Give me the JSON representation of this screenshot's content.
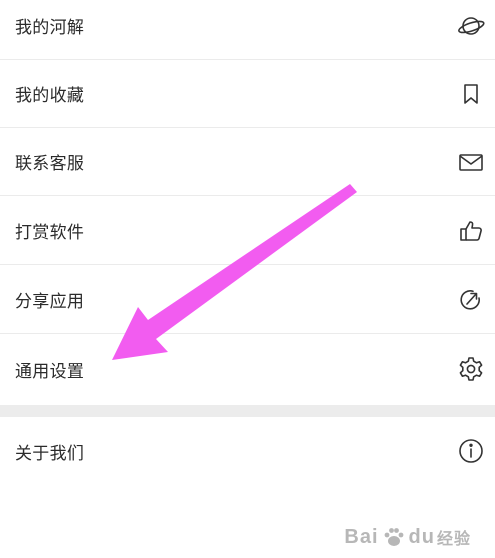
{
  "menu": {
    "items": [
      {
        "label": "我的河解",
        "icon": "planet-icon"
      },
      {
        "label": "我的收藏",
        "icon": "bookmark-icon"
      },
      {
        "label": "联系客服",
        "icon": "mail-icon"
      },
      {
        "label": "打赏软件",
        "icon": "thumbs-up-icon"
      },
      {
        "label": "分享应用",
        "icon": "share-icon"
      },
      {
        "label": "通用设置",
        "icon": "gear-icon"
      }
    ],
    "about": {
      "label": "关于我们",
      "icon": "info-icon"
    }
  },
  "annotation": {
    "color": "#f25cf0"
  },
  "watermark": {
    "brand": "Bai",
    "brand2": "du",
    "suffix": "经验"
  }
}
